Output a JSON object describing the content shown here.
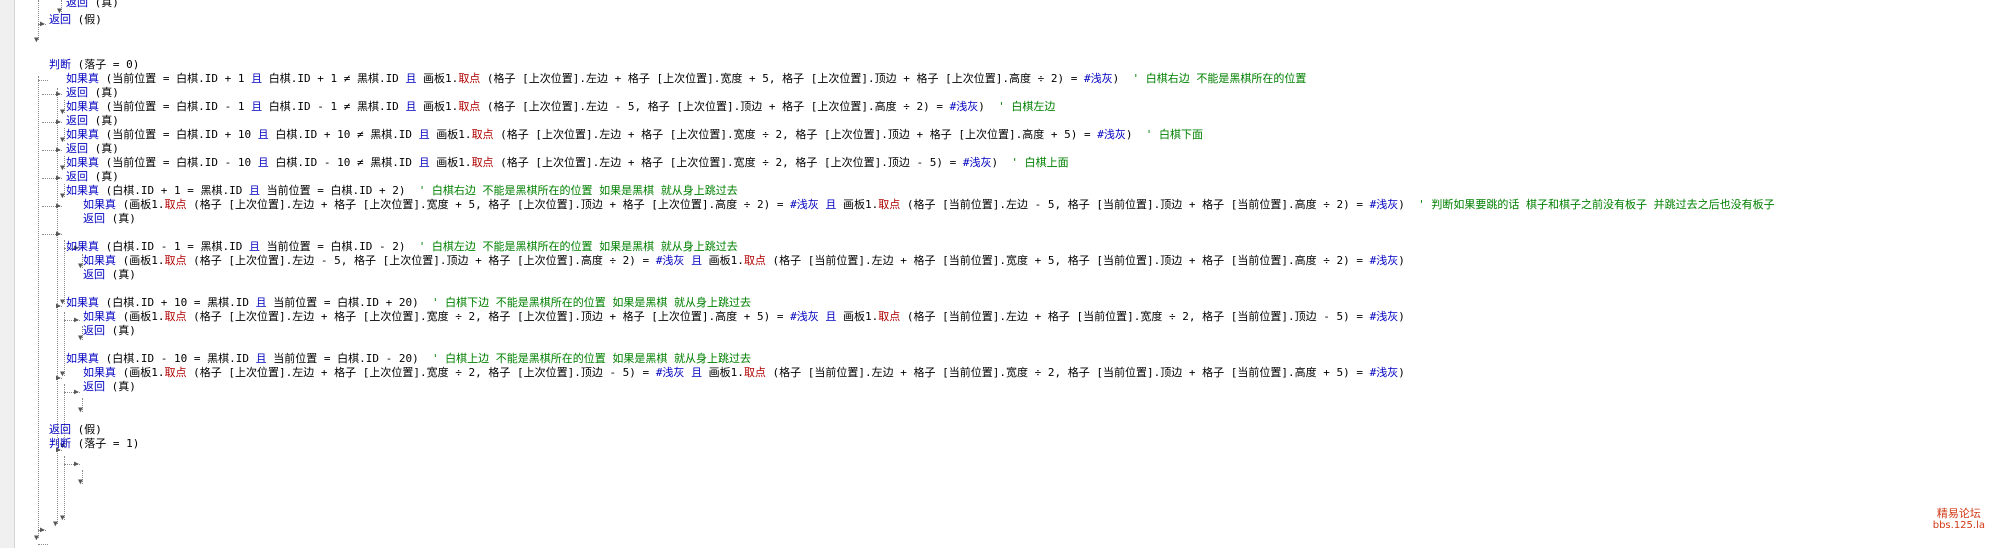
{
  "code_lines": [
    [
      {
        "c": "kw",
        "t": "返回"
      },
      {
        "c": "op",
        "t": " (真)"
      }
    ],
    [
      {
        "c": "kw",
        "t": "返回"
      },
      {
        "c": "op",
        "t": " (假)"
      }
    ],
    [],
    [],
    [
      {
        "c": "kw",
        "t": "判断"
      },
      {
        "c": "op",
        "t": " (落子 = 0)"
      }
    ],
    [
      {
        "c": "kw",
        "t": "如果真"
      },
      {
        "c": "op",
        "t": " (当前位置 = 白棋.ID + 1 "
      },
      {
        "c": "kw",
        "t": "且"
      },
      {
        "c": "op",
        "t": " 白棋.ID + 1 ≠ 黑棋.ID "
      },
      {
        "c": "kw",
        "t": "且"
      },
      {
        "c": "op",
        "t": " 画板1."
      },
      {
        "c": "fn",
        "t": "取点"
      },
      {
        "c": "op",
        "t": " (格子 [上次位置].左边 + 格子 [上次位置].宽度 + 5, 格子 [上次位置].顶边 + 格子 [上次位置].高度 ÷ 2) = "
      },
      {
        "c": "cn",
        "t": "#浅灰"
      },
      {
        "c": "op",
        "t": ")  "
      },
      {
        "c": "cm",
        "t": "' 白棋右边 不能是黑棋所在的位置"
      }
    ],
    [
      {
        "c": "kw",
        "t": "返回"
      },
      {
        "c": "op",
        "t": " (真)"
      }
    ],
    [
      {
        "c": "kw",
        "t": "如果真"
      },
      {
        "c": "op",
        "t": " (当前位置 = 白棋.ID - 1 "
      },
      {
        "c": "kw",
        "t": "且"
      },
      {
        "c": "op",
        "t": " 白棋.ID - 1 ≠ 黑棋.ID "
      },
      {
        "c": "kw",
        "t": "且"
      },
      {
        "c": "op",
        "t": " 画板1."
      },
      {
        "c": "fn",
        "t": "取点"
      },
      {
        "c": "op",
        "t": " (格子 [上次位置].左边 - 5, 格子 [上次位置].顶边 + 格子 [上次位置].高度 ÷ 2) = "
      },
      {
        "c": "cn",
        "t": "#浅灰"
      },
      {
        "c": "op",
        "t": ")  "
      },
      {
        "c": "cm",
        "t": "' 白棋左边"
      }
    ],
    [
      {
        "c": "kw",
        "t": "返回"
      },
      {
        "c": "op",
        "t": " (真)"
      }
    ],
    [
      {
        "c": "kw",
        "t": "如果真"
      },
      {
        "c": "op",
        "t": " (当前位置 = 白棋.ID + 10 "
      },
      {
        "c": "kw",
        "t": "且"
      },
      {
        "c": "op",
        "t": " 白棋.ID + 10 ≠ 黑棋.ID "
      },
      {
        "c": "kw",
        "t": "且"
      },
      {
        "c": "op",
        "t": " 画板1."
      },
      {
        "c": "fn",
        "t": "取点"
      },
      {
        "c": "op",
        "t": " (格子 [上次位置].左边 + 格子 [上次位置].宽度 ÷ 2, 格子 [上次位置].顶边 + 格子 [上次位置].高度 + 5) = "
      },
      {
        "c": "cn",
        "t": "#浅灰"
      },
      {
        "c": "op",
        "t": ")  "
      },
      {
        "c": "cm",
        "t": "' 白棋下面"
      }
    ],
    [
      {
        "c": "kw",
        "t": "返回"
      },
      {
        "c": "op",
        "t": " (真)"
      }
    ],
    [
      {
        "c": "kw",
        "t": "如果真"
      },
      {
        "c": "op",
        "t": " (当前位置 = 白棋.ID - 10 "
      },
      {
        "c": "kw",
        "t": "且"
      },
      {
        "c": "op",
        "t": " 白棋.ID - 10 ≠ 黑棋.ID "
      },
      {
        "c": "kw",
        "t": "且"
      },
      {
        "c": "op",
        "t": " 画板1."
      },
      {
        "c": "fn",
        "t": "取点"
      },
      {
        "c": "op",
        "t": " (格子 [上次位置].左边 + 格子 [上次位置].宽度 ÷ 2, 格子 [上次位置].顶边 - 5) = "
      },
      {
        "c": "cn",
        "t": "#浅灰"
      },
      {
        "c": "op",
        "t": ")  "
      },
      {
        "c": "cm",
        "t": "' 白棋上面"
      }
    ],
    [
      {
        "c": "kw",
        "t": "返回"
      },
      {
        "c": "op",
        "t": " (真)"
      }
    ],
    [
      {
        "c": "kw",
        "t": "如果真"
      },
      {
        "c": "op",
        "t": " (白棋.ID + 1 = 黑棋.ID "
      },
      {
        "c": "kw",
        "t": "且"
      },
      {
        "c": "op",
        "t": " 当前位置 = 白棋.ID + 2)  "
      },
      {
        "c": "cm",
        "t": "' 白棋右边 不能是黑棋所在的位置 如果是黑棋 就从身上跳过去"
      }
    ],
    [
      {
        "c": "kw",
        "t": "如果真"
      },
      {
        "c": "op",
        "t": " (画板1."
      },
      {
        "c": "fn",
        "t": "取点"
      },
      {
        "c": "op",
        "t": " (格子 [上次位置].左边 + 格子 [上次位置].宽度 + 5, 格子 [上次位置].顶边 + 格子 [上次位置].高度 ÷ 2) = "
      },
      {
        "c": "cn",
        "t": "#浅灰"
      },
      {
        "c": "op",
        "t": " "
      },
      {
        "c": "kw",
        "t": "且"
      },
      {
        "c": "op",
        "t": " 画板1."
      },
      {
        "c": "fn",
        "t": "取点"
      },
      {
        "c": "op",
        "t": " (格子 [当前位置].左边 - 5, 格子 [当前位置].顶边 + 格子 [当前位置].高度 ÷ 2) = "
      },
      {
        "c": "cn",
        "t": "#浅灰"
      },
      {
        "c": "op",
        "t": ")  "
      },
      {
        "c": "cm",
        "t": "' 判断如果要跳的话 棋子和棋子之前没有板子 并跳过去之后也没有板子"
      }
    ],
    [
      {
        "c": "kw",
        "t": "返回"
      },
      {
        "c": "op",
        "t": " (真)"
      }
    ],
    [],
    [
      {
        "c": "kw",
        "t": "如果真"
      },
      {
        "c": "op",
        "t": " (白棋.ID - 1 = 黑棋.ID "
      },
      {
        "c": "kw",
        "t": "且"
      },
      {
        "c": "op",
        "t": " 当前位置 = 白棋.ID - 2)  "
      },
      {
        "c": "cm",
        "t": "' 白棋左边 不能是黑棋所在的位置 如果是黑棋 就从身上跳过去"
      }
    ],
    [
      {
        "c": "kw",
        "t": "如果真"
      },
      {
        "c": "op",
        "t": " (画板1."
      },
      {
        "c": "fn",
        "t": "取点"
      },
      {
        "c": "op",
        "t": " (格子 [上次位置].左边 - 5, 格子 [上次位置].顶边 + 格子 [上次位置].高度 ÷ 2) = "
      },
      {
        "c": "cn",
        "t": "#浅灰"
      },
      {
        "c": "op",
        "t": " "
      },
      {
        "c": "kw",
        "t": "且"
      },
      {
        "c": "op",
        "t": " 画板1."
      },
      {
        "c": "fn",
        "t": "取点"
      },
      {
        "c": "op",
        "t": " (格子 [当前位置].左边 + 格子 [当前位置].宽度 + 5, 格子 [当前位置].顶边 + 格子 [当前位置].高度 ÷ 2) = "
      },
      {
        "c": "cn",
        "t": "#浅灰"
      },
      {
        "c": "op",
        "t": ")"
      }
    ],
    [
      {
        "c": "kw",
        "t": "返回"
      },
      {
        "c": "op",
        "t": " (真)"
      }
    ],
    [],
    [
      {
        "c": "kw",
        "t": "如果真"
      },
      {
        "c": "op",
        "t": " (白棋.ID + 10 = 黑棋.ID "
      },
      {
        "c": "kw",
        "t": "且"
      },
      {
        "c": "op",
        "t": " 当前位置 = 白棋.ID + 20)  "
      },
      {
        "c": "cm",
        "t": "' 白棋下边 不能是黑棋所在的位置 如果是黑棋 就从身上跳过去"
      }
    ],
    [
      {
        "c": "kw",
        "t": "如果真"
      },
      {
        "c": "op",
        "t": " (画板1."
      },
      {
        "c": "fn",
        "t": "取点"
      },
      {
        "c": "op",
        "t": " (格子 [上次位置].左边 + 格子 [上次位置].宽度 ÷ 2, 格子 [上次位置].顶边 + 格子 [上次位置].高度 + 5) = "
      },
      {
        "c": "cn",
        "t": "#浅灰"
      },
      {
        "c": "op",
        "t": " "
      },
      {
        "c": "kw",
        "t": "且"
      },
      {
        "c": "op",
        "t": " 画板1."
      },
      {
        "c": "fn",
        "t": "取点"
      },
      {
        "c": "op",
        "t": " (格子 [当前位置].左边 + 格子 [当前位置].宽度 ÷ 2, 格子 [当前位置].顶边 - 5) = "
      },
      {
        "c": "cn",
        "t": "#浅灰"
      },
      {
        "c": "op",
        "t": ")"
      }
    ],
    [
      {
        "c": "kw",
        "t": "返回"
      },
      {
        "c": "op",
        "t": " (真)"
      }
    ],
    [],
    [
      {
        "c": "kw",
        "t": "如果真"
      },
      {
        "c": "op",
        "t": " (白棋.ID - 10 = 黑棋.ID "
      },
      {
        "c": "kw",
        "t": "且"
      },
      {
        "c": "op",
        "t": " 当前位置 = 白棋.ID - 20)  "
      },
      {
        "c": "cm",
        "t": "' 白棋上边 不能是黑棋所在的位置 如果是黑棋 就从身上跳过去"
      }
    ],
    [
      {
        "c": "kw",
        "t": "如果真"
      },
      {
        "c": "op",
        "t": " (画板1."
      },
      {
        "c": "fn",
        "t": "取点"
      },
      {
        "c": "op",
        "t": " (格子 [上次位置].左边 + 格子 [上次位置].宽度 ÷ 2, 格子 [上次位置].顶边 - 5) = "
      },
      {
        "c": "cn",
        "t": "#浅灰"
      },
      {
        "c": "op",
        "t": " "
      },
      {
        "c": "kw",
        "t": "且"
      },
      {
        "c": "op",
        "t": " 画板1."
      },
      {
        "c": "fn",
        "t": "取点"
      },
      {
        "c": "op",
        "t": " (格子 [当前位置].左边 + 格子 [当前位置].宽度 ÷ 2, 格子 [当前位置].顶边 + 格子 [当前位置].高度 + 5) = "
      },
      {
        "c": "cn",
        "t": "#浅灰"
      },
      {
        "c": "op",
        "t": ")"
      }
    ],
    [
      {
        "c": "kw",
        "t": "返回"
      },
      {
        "c": "op",
        "t": " (真)"
      }
    ],
    [],
    [],
    [
      {
        "c": "kw",
        "t": "返回"
      },
      {
        "c": "op",
        "t": " (假)"
      }
    ],
    [
      {
        "c": "kw",
        "t": "判断"
      },
      {
        "c": "op",
        "t": " (落子 = 1)"
      }
    ]
  ],
  "watermark": {
    "line1": "精易论坛",
    "line2": "bbs.125.la"
  },
  "colors": {
    "keyword": "#0000c0",
    "function": "#b00000",
    "comment": "#008000",
    "guide": "#8a8a8a",
    "watermark": "#d23a17"
  }
}
